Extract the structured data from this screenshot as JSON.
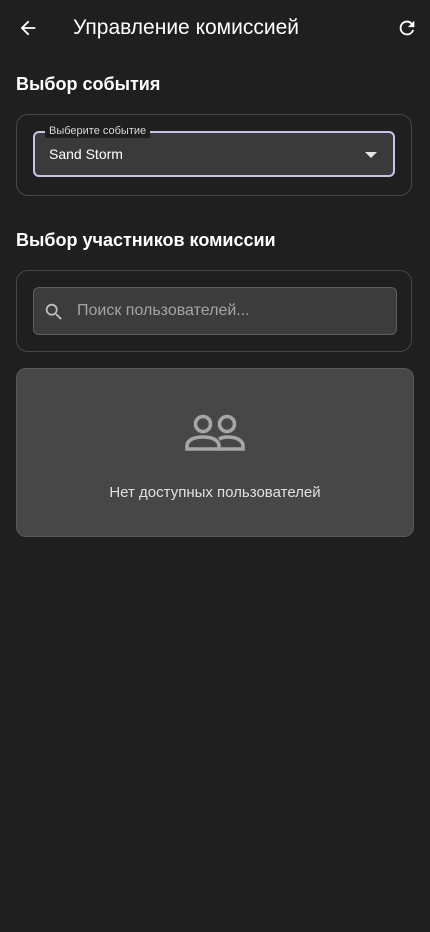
{
  "app_bar": {
    "title": "Управление комиссией",
    "back_icon": "arrow-left-icon",
    "refresh_icon": "refresh-icon"
  },
  "event_section": {
    "title": "Выбор события",
    "select": {
      "label": "Выберите событие",
      "value": "Sand Storm"
    }
  },
  "members_section": {
    "title": "Выбор участников комиссии",
    "search": {
      "placeholder": "Поиск пользователей...",
      "value": "",
      "icon": "search-icon"
    },
    "empty_state": {
      "icon": "people-icon",
      "message": "Нет доступных пользователей"
    }
  },
  "colors": {
    "background": "#1f1f1f",
    "select_border": "#c8c4e6",
    "empty_card": "#474747"
  }
}
